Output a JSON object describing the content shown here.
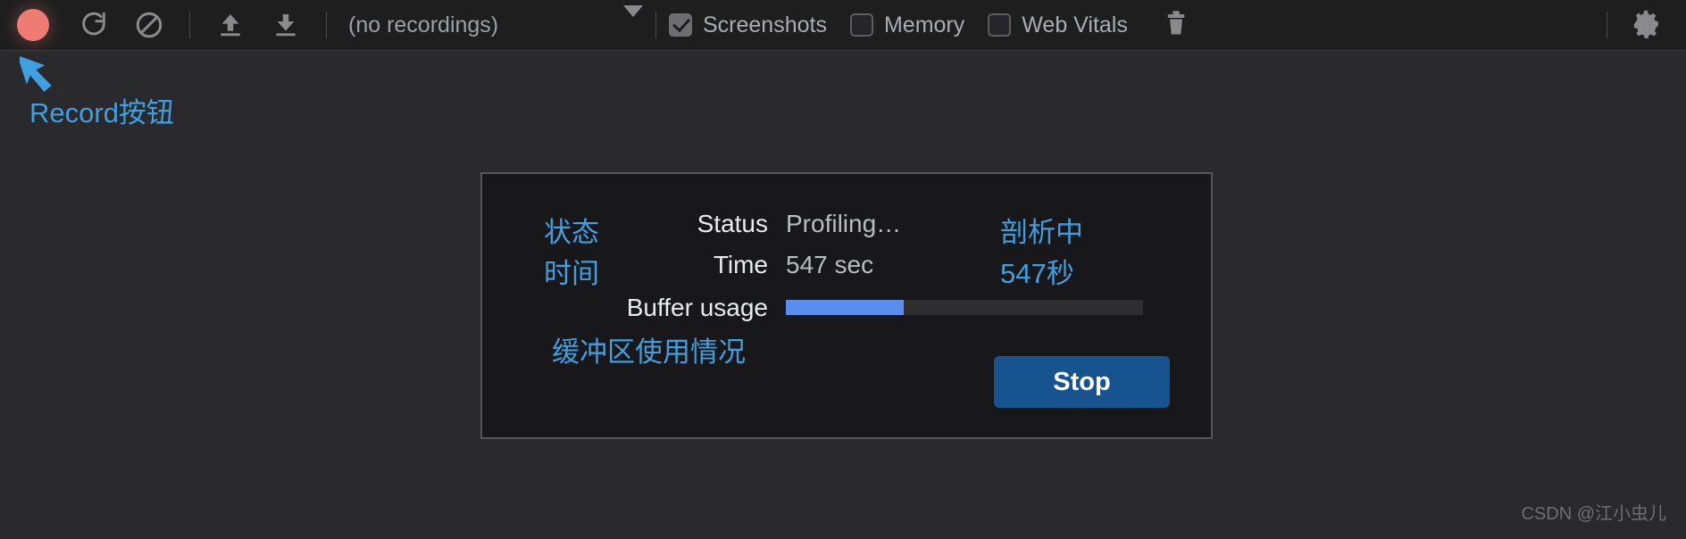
{
  "toolbar": {
    "record_button": "record-dot",
    "reload_icon": "reload-icon",
    "clear_icon": "no-entry-icon",
    "import_icon": "upload-arrow-icon",
    "export_icon": "download-arrow-icon",
    "recordings_label": "(no recordings)",
    "recordings_caret": "chevron-down-icon",
    "checkboxes": [
      {
        "label": "Screenshots",
        "checked": true
      },
      {
        "label": "Memory",
        "checked": false
      },
      {
        "label": "Web Vitals",
        "checked": false
      }
    ],
    "trash_icon": "trash-icon",
    "settings_icon": "gear-icon"
  },
  "annotations": {
    "record_label": "Record按钮",
    "accent_color": "#3f9fe0"
  },
  "dialog": {
    "rows": [
      {
        "cn_left": "状态",
        "en_key": "Status",
        "en_value": "Profiling…",
        "cn_right": "剖析中"
      },
      {
        "cn_left": "时间",
        "en_key": "Time",
        "en_value": "547 sec",
        "cn_right": "547秒"
      }
    ],
    "buffer": {
      "label": "Buffer usage",
      "cn_label": "缓冲区使用情况",
      "percent": 33,
      "fill_color": "#5b8dee",
      "track_color": "#2e2e31"
    },
    "stop_button": "Stop",
    "stop_button_color": "#17538f"
  },
  "watermark": "CSDN @江小虫儿"
}
